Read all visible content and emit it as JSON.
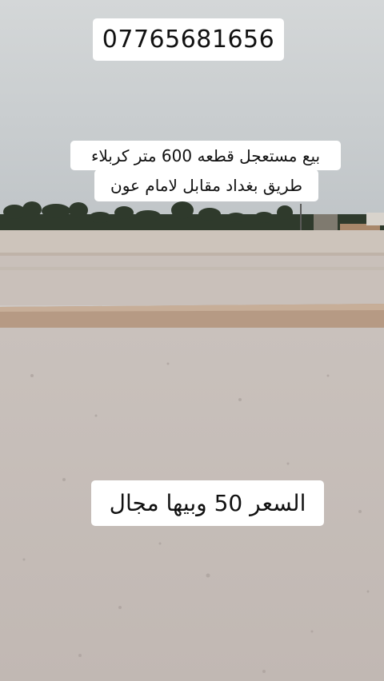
{
  "overlay": {
    "phone": "07765681656",
    "ad_line_1": "بيع مستعجل قطعه 600 متر كربلاء",
    "ad_line_2": "طريق بغداد مقابل لامام عون",
    "price": "السعر 50 وبيها مجال"
  },
  "colors": {
    "sky": "#c4c9cc",
    "wall": "#cdc4bb",
    "ground": "#c5bdb8",
    "ridge": "#b69a84",
    "caption_bg": "#ffffff"
  }
}
